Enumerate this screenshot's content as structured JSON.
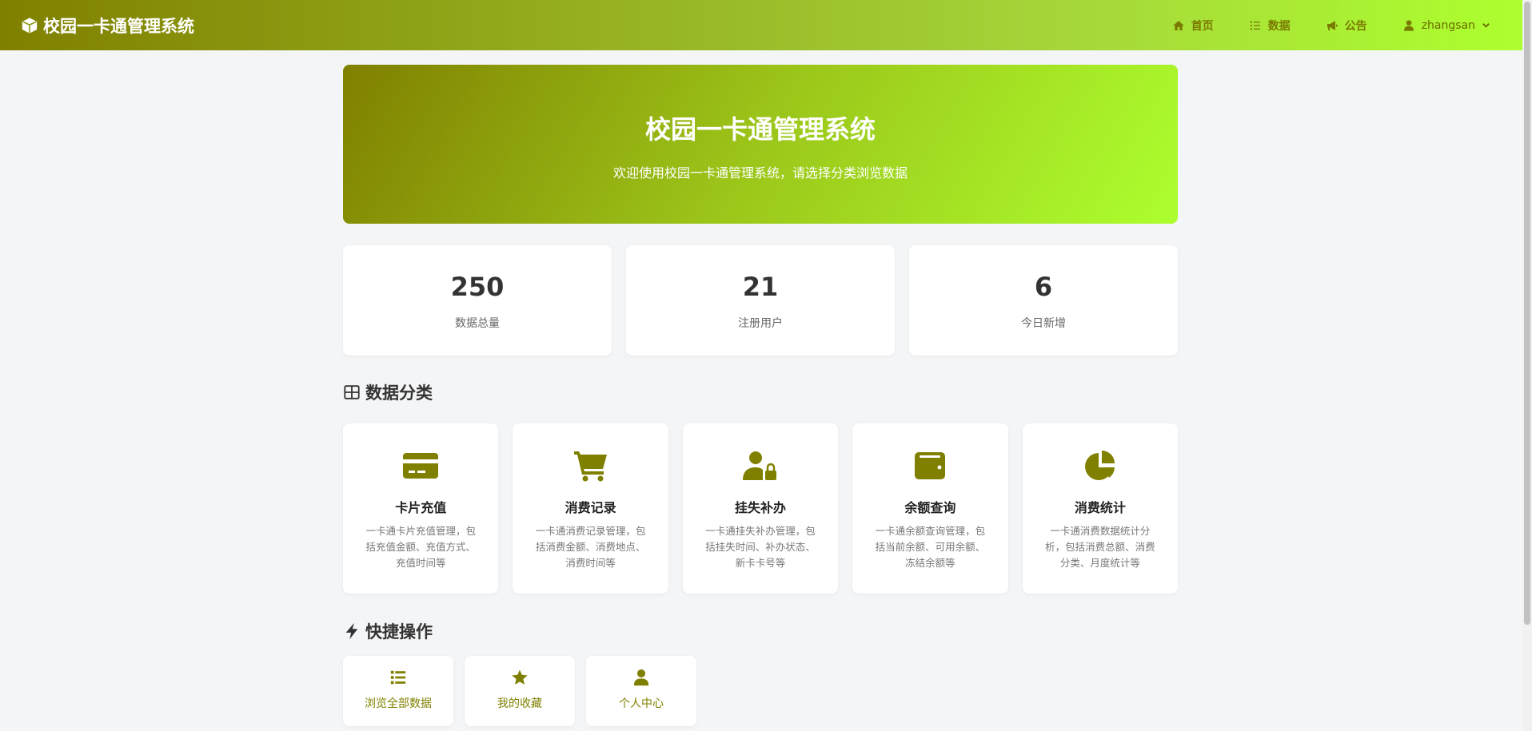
{
  "brand": {
    "title": "校园一卡通管理系统",
    "icon": "cube-icon"
  },
  "nav": {
    "items": [
      {
        "label": "首页",
        "icon": "home-icon"
      },
      {
        "label": "数据",
        "icon": "list-icon"
      },
      {
        "label": "公告",
        "icon": "megaphone-icon"
      }
    ],
    "user": {
      "name": "zhangsan",
      "icon": "user-icon"
    }
  },
  "hero": {
    "title": "校园一卡通管理系统",
    "subtitle": "欢迎使用校园一卡通管理系统，请选择分类浏览数据"
  },
  "stats": [
    {
      "value": "250",
      "label": "数据总量"
    },
    {
      "value": "21",
      "label": "注册用户"
    },
    {
      "value": "6",
      "label": "今日新增"
    }
  ],
  "categories_section": {
    "title": "数据分类",
    "icon": "grid-icon"
  },
  "categories": [
    {
      "title": "卡片充值",
      "desc": "一卡通卡片充值管理，包括充值金额、充值方式、充值时间等",
      "icon": "credit-card-icon"
    },
    {
      "title": "消费记录",
      "desc": "一卡通消费记录管理，包括消费金额、消费地点、消费时间等",
      "icon": "cart-icon"
    },
    {
      "title": "挂失补办",
      "desc": "一卡通挂失补办管理，包括挂失时间、补办状态、新卡卡号等",
      "icon": "user-lock-icon"
    },
    {
      "title": "余额查询",
      "desc": "一卡通余额查询管理，包括当前余额、可用余额、冻结余额等",
      "icon": "wallet-icon"
    },
    {
      "title": "消费统计",
      "desc": "一卡通消费数据统计分析，包括消费总额、消费分类、月度统计等",
      "icon": "pie-chart-icon"
    }
  ],
  "quick_section": {
    "title": "快捷操作",
    "icon": "bolt-icon"
  },
  "quick": [
    {
      "label": "浏览全部数据",
      "icon": "list-icon"
    },
    {
      "label": "我的收藏",
      "icon": "star-icon"
    },
    {
      "label": "个人中心",
      "icon": "user-icon"
    }
  ],
  "colors": {
    "accent": "#808000",
    "gradient_end": "#adff2f",
    "background": "#f4f5f7"
  }
}
